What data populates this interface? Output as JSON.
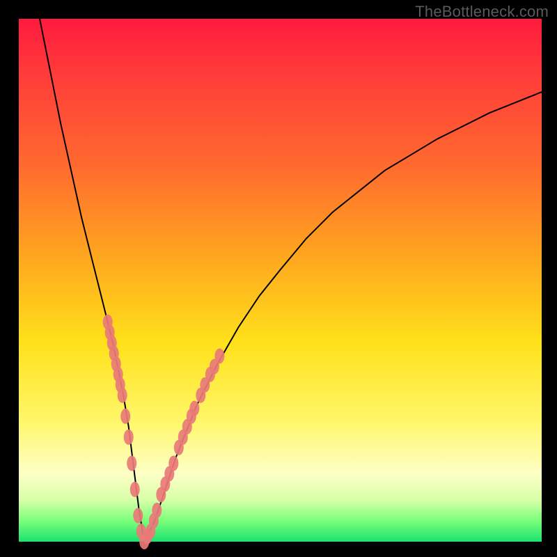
{
  "watermark": "TheBottleneck.com",
  "colors": {
    "frame": "#000000",
    "gradient_top": "#ff1a3e",
    "gradient_mid1": "#ff6a2f",
    "gradient_mid2": "#ffe11a",
    "gradient_bottom": "#19e36e",
    "curve": "#000000",
    "markers": "#e97a78"
  },
  "chart_data": {
    "type": "line",
    "title": "",
    "xlabel": "",
    "ylabel": "",
    "xlim": [
      0,
      100
    ],
    "ylim": [
      0,
      100
    ],
    "grid": false,
    "legend": false,
    "series": [
      {
        "name": "bottleneck-curve",
        "x": [
          4,
          6,
          8,
          10,
          12,
          14,
          16,
          18,
          20,
          21,
          22,
          23,
          24,
          26,
          28,
          30,
          34,
          38,
          42,
          46,
          50,
          55,
          60,
          65,
          70,
          75,
          80,
          85,
          90,
          95,
          100
        ],
        "y": [
          100,
          90,
          80,
          71,
          62,
          54,
          46,
          38,
          28,
          22,
          14,
          6,
          0,
          4,
          10,
          16,
          26,
          34,
          41,
          47,
          52,
          58,
          63,
          67,
          71,
          74,
          77,
          79.5,
          82,
          84,
          86
        ]
      }
    ],
    "markers": {
      "name": "highlight-dots",
      "points": [
        {
          "x": 17.0,
          "y": 42
        },
        {
          "x": 17.4,
          "y": 40
        },
        {
          "x": 17.8,
          "y": 38
        },
        {
          "x": 18.2,
          "y": 36
        },
        {
          "x": 18.6,
          "y": 34
        },
        {
          "x": 19.0,
          "y": 32
        },
        {
          "x": 19.4,
          "y": 30
        },
        {
          "x": 19.8,
          "y": 28
        },
        {
          "x": 20.4,
          "y": 24
        },
        {
          "x": 21.0,
          "y": 20
        },
        {
          "x": 21.6,
          "y": 15
        },
        {
          "x": 22.2,
          "y": 10
        },
        {
          "x": 22.8,
          "y": 5
        },
        {
          "x": 23.4,
          "y": 2
        },
        {
          "x": 24.0,
          "y": 0
        },
        {
          "x": 24.6,
          "y": 1
        },
        {
          "x": 25.2,
          "y": 2
        },
        {
          "x": 25.8,
          "y": 4
        },
        {
          "x": 26.4,
          "y": 6
        },
        {
          "x": 27.2,
          "y": 9
        },
        {
          "x": 28.0,
          "y": 11
        },
        {
          "x": 28.8,
          "y": 13
        },
        {
          "x": 29.6,
          "y": 15
        },
        {
          "x": 30.6,
          "y": 18
        },
        {
          "x": 31.4,
          "y": 20
        },
        {
          "x": 32.2,
          "y": 22
        },
        {
          "x": 33.0,
          "y": 24
        },
        {
          "x": 33.6,
          "y": 25.5
        },
        {
          "x": 34.8,
          "y": 28
        },
        {
          "x": 35.6,
          "y": 30
        },
        {
          "x": 36.6,
          "y": 32
        },
        {
          "x": 37.4,
          "y": 33.5
        },
        {
          "x": 38.4,
          "y": 35.5
        }
      ]
    }
  }
}
